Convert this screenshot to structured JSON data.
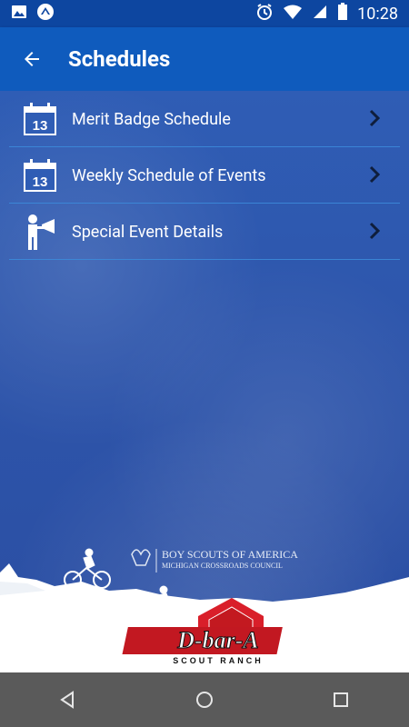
{
  "status_bar": {
    "time": "10:28",
    "left_icons": [
      "image-icon",
      "app-notification-icon"
    ],
    "right_icons": [
      "alarm-icon",
      "wifi-icon",
      "signal-icon",
      "battery-icon"
    ]
  },
  "app_bar": {
    "title": "Schedules",
    "back_icon": "arrow-left-icon"
  },
  "menu": {
    "items": [
      {
        "label": "Merit Badge Schedule",
        "icon": "calendar-13-icon"
      },
      {
        "label": "Weekly Schedule of Events",
        "icon": "calendar-13-icon"
      },
      {
        "label": "Special Event Details",
        "icon": "megaphone-person-icon"
      }
    ],
    "calendar_day": "13"
  },
  "footer": {
    "bsa_line1": "BOY SCOUTS OF AMERICA",
    "bsa_line2": "MICHIGAN CROSSROADS COUNCIL",
    "ranch_name": "D-bar-A",
    "ranch_sub": "SCOUT RANCH"
  },
  "nav_bar": {
    "buttons": [
      "back-triangle-icon",
      "home-circle-icon",
      "recents-square-icon"
    ]
  },
  "colors": {
    "status_bar": "#0d46a0",
    "app_bar": "#0f5bbd",
    "content_bg": "#2f55a8",
    "divider": "#3c8cdc",
    "nav_bar": "#5a5a5a"
  }
}
